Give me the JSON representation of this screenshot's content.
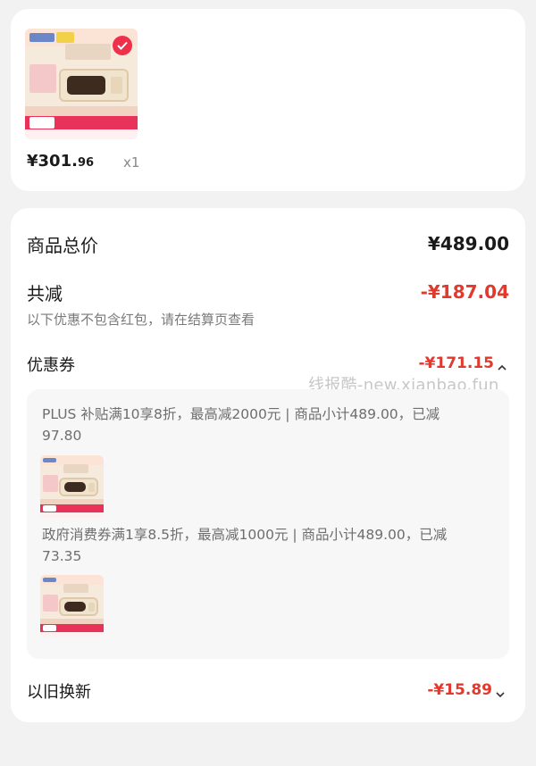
{
  "product": {
    "price_symbol": "¥",
    "price_int": "301.",
    "price_dec": "96",
    "quantity": "x1",
    "image_icon": "microwave-product-image",
    "selected_icon": "checkmark-icon"
  },
  "summary": {
    "total_label": "商品总价",
    "total_value": "¥489.00",
    "discount_label": "共减",
    "discount_value": "-¥187.04",
    "note": "以下优惠不包含红包，请在结算页查看"
  },
  "coupons": {
    "label": "优惠券",
    "value": "-¥171.15",
    "watermark": "线报酷-new.xianbao.fun",
    "items": [
      {
        "text_line1": "PLUS 补贴满10享8折，最高减2000元 | 商品小计489.00，已减",
        "text_line2": "97.80"
      },
      {
        "text_line1": "政府消费券满1享8.5折，最高减1000元 | 商品小计489.00，已减",
        "text_line2": "73.35"
      }
    ]
  },
  "trade_in": {
    "label": "以旧换新",
    "value": "-¥15.89"
  },
  "colors": {
    "accent_red": "#e03a2e",
    "page_bg": "#f2f2f2",
    "card_bg": "#ffffff"
  }
}
